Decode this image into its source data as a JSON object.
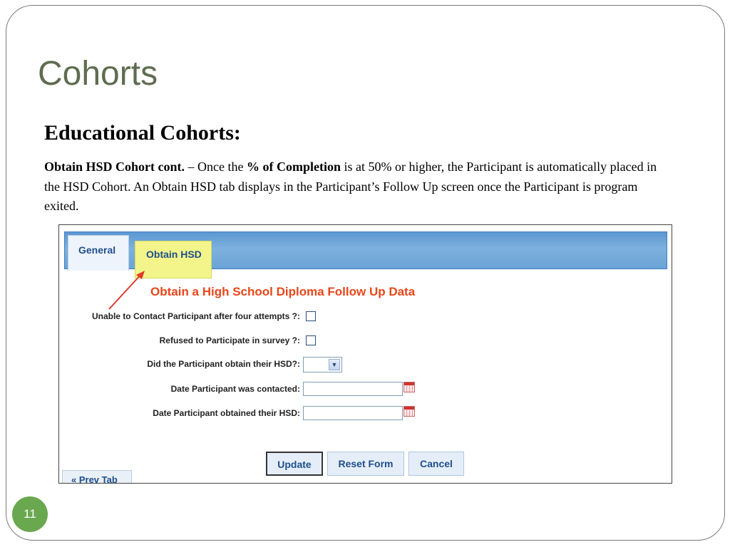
{
  "slide": {
    "title": "Cohorts",
    "heading": "Educational Cohorts:",
    "body": {
      "lead": "Obtain HSD Cohort cont.",
      "sep": " – Once the ",
      "emph": "% of Completion",
      "rest": " is at 50% or higher, the Participant is automatically placed in the HSD Cohort.  An Obtain HSD tab displays in the Participant’s Follow Up screen once the Participant is program exited."
    },
    "page_number": "11"
  },
  "screen": {
    "tabs": [
      {
        "label": "General"
      },
      {
        "label": "Obtain HSD"
      }
    ],
    "form_title": "Obtain a High School Diploma Follow Up Data",
    "fields": {
      "unable_contact": {
        "label": "Unable to Contact Participant after four attempts ?:"
      },
      "refused": {
        "label": "Refused to Participate in survey ?:"
      },
      "obtained_hsd": {
        "label": "Did the Participant obtain their HSD?:",
        "value": ""
      },
      "date_contacted": {
        "label": "Date Participant was contacted:",
        "value": ""
      },
      "date_obtained": {
        "label": "Date Participant obtained their HSD:",
        "value": ""
      }
    },
    "buttons": {
      "update": "Update",
      "reset": "Reset Form",
      "cancel": "Cancel"
    },
    "prev_tab": "« Prev Tab"
  },
  "colors": {
    "title": "#5e6d50",
    "form_title": "#e8461a",
    "tab_highlight": "#f3f58a",
    "arrow": "#e03a2a",
    "badge": "#6aa84f"
  },
  "icons": [
    "select-arrow-icon",
    "calendar-icon",
    "annotation-arrow-icon"
  ]
}
